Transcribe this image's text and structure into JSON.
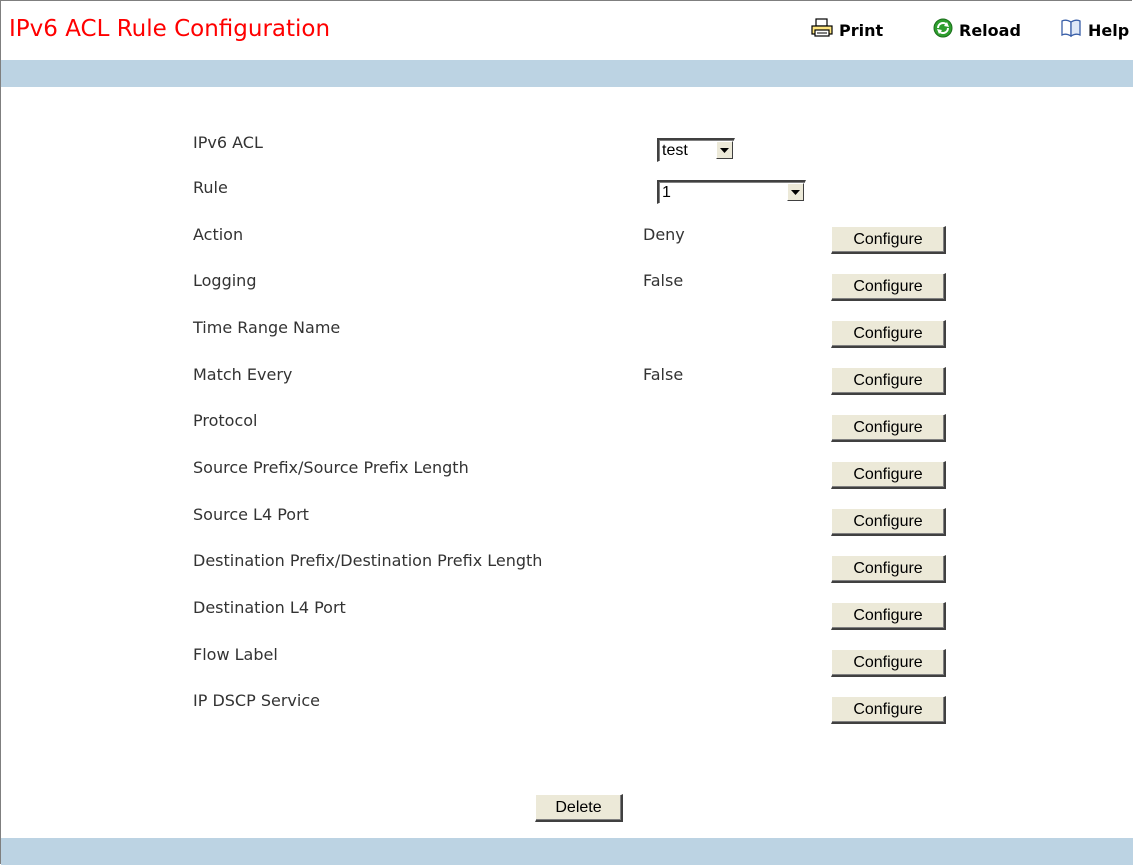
{
  "header": {
    "title": "IPv6 ACL Rule Configuration",
    "print_label": "Print",
    "reload_label": "Reload",
    "help_label": "Help"
  },
  "form": {
    "acl": {
      "label": "IPv6 ACL",
      "selected": "test"
    },
    "rule": {
      "label": "Rule",
      "selected": "1"
    },
    "rows": [
      {
        "label": "Action",
        "value": "Deny",
        "button": "Configure"
      },
      {
        "label": "Logging",
        "value": "False",
        "button": "Configure"
      },
      {
        "label": "Time Range Name",
        "value": "",
        "button": "Configure"
      },
      {
        "label": "Match Every",
        "value": "False",
        "button": "Configure"
      },
      {
        "label": "Protocol",
        "value": "",
        "button": "Configure"
      },
      {
        "label": "Source Prefix/Source Prefix Length",
        "value": "",
        "button": "Configure"
      },
      {
        "label": "Source L4 Port",
        "value": "",
        "button": "Configure"
      },
      {
        "label": "Destination Prefix/Destination Prefix Length",
        "value": "",
        "button": "Configure"
      },
      {
        "label": "Destination L4 Port",
        "value": "",
        "button": "Configure"
      },
      {
        "label": "Flow Label",
        "value": "",
        "button": "Configure"
      },
      {
        "label": "IP DSCP Service",
        "value": "",
        "button": "Configure"
      }
    ],
    "delete_label": "Delete"
  },
  "colors": {
    "title": "#ff0000",
    "band": "#bcd3e3",
    "button_face": "#ece9d8"
  },
  "icons": {
    "print": "printer-icon",
    "reload": "reload-icon",
    "help": "book-icon"
  }
}
